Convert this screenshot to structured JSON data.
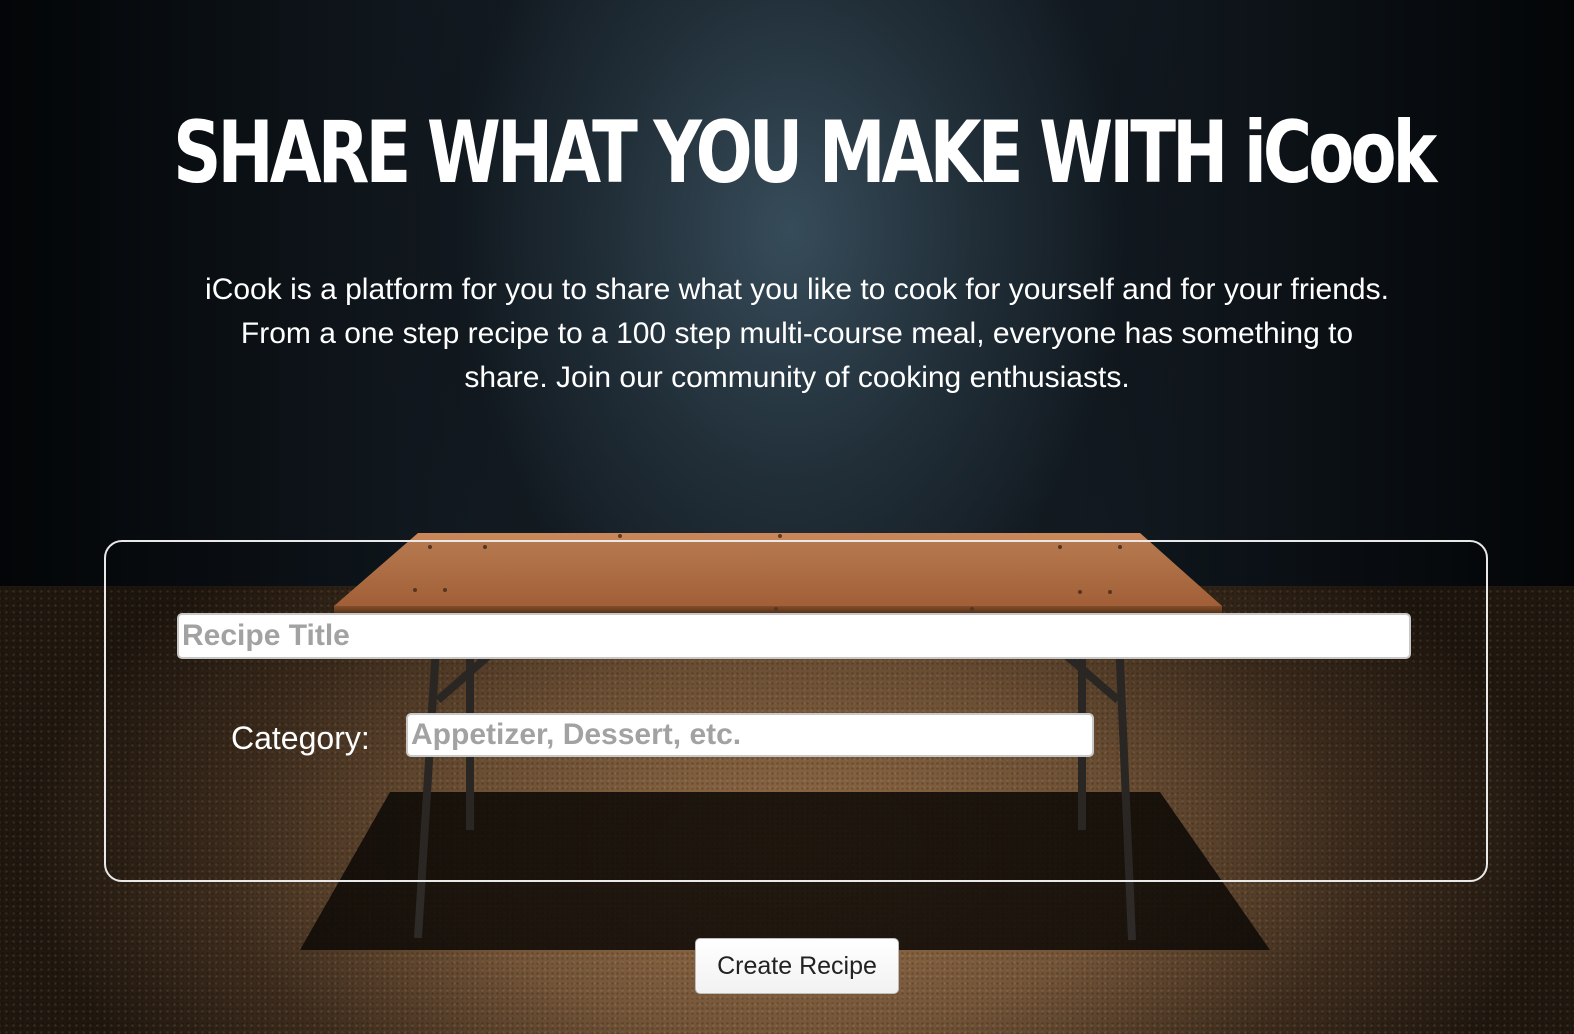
{
  "hero": {
    "headline": "SHARE WHAT YOU MAKE WITH iCook",
    "intro": "iCook is a platform for you to share what you like to cook for yourself and for your friends. From a one step recipe to a 100 step multi-course meal, everyone has something to share. Join our community of cooking enthusiasts."
  },
  "form": {
    "title_placeholder": "Recipe Title",
    "title_value": "",
    "category_label": "Category:",
    "category_placeholder": "Appetizer, Dessert, etc.",
    "category_value": "",
    "submit_label": "Create Recipe"
  },
  "colors": {
    "text": "#ffffff",
    "panel_border": "#e9e9e9",
    "placeholder": "#a2a2a2"
  }
}
